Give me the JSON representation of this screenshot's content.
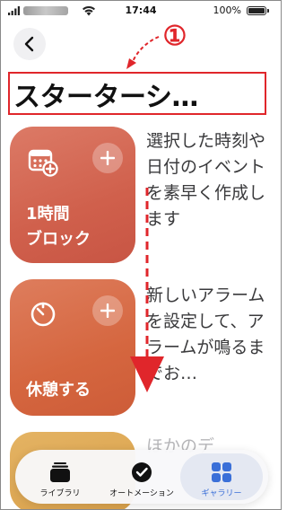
{
  "status_bar": {
    "time": "17:44",
    "battery": "100%"
  },
  "annotation": {
    "number": "①",
    "color": "#e0262b"
  },
  "header": {
    "title": "スターターシ…"
  },
  "shortcuts": [
    {
      "label_line1": "1時間",
      "label_line2": "ブロック",
      "icon": "calendar-add-icon",
      "color": "#d0604c",
      "description": "選択した時刻や日付のイベントを素早く作成します"
    },
    {
      "label_line1": "休憩する",
      "icon": "timer-icon",
      "color": "#d5663f",
      "description": "新しいアラームを設定して、アラームが鳴るまでお…"
    },
    {
      "icon": "",
      "color": "#d9a04a",
      "description": "ほかのデ"
    }
  ],
  "tab_bar": {
    "tabs": [
      {
        "label": "ライブラリ",
        "icon": "library-stack-icon",
        "selected": false
      },
      {
        "label": "オートメーション",
        "icon": "automation-clock-icon",
        "selected": false
      },
      {
        "label": "ギャラリー",
        "icon": "gallery-grid-icon",
        "selected": true
      }
    ],
    "accent_color": "#3a6fd8"
  }
}
